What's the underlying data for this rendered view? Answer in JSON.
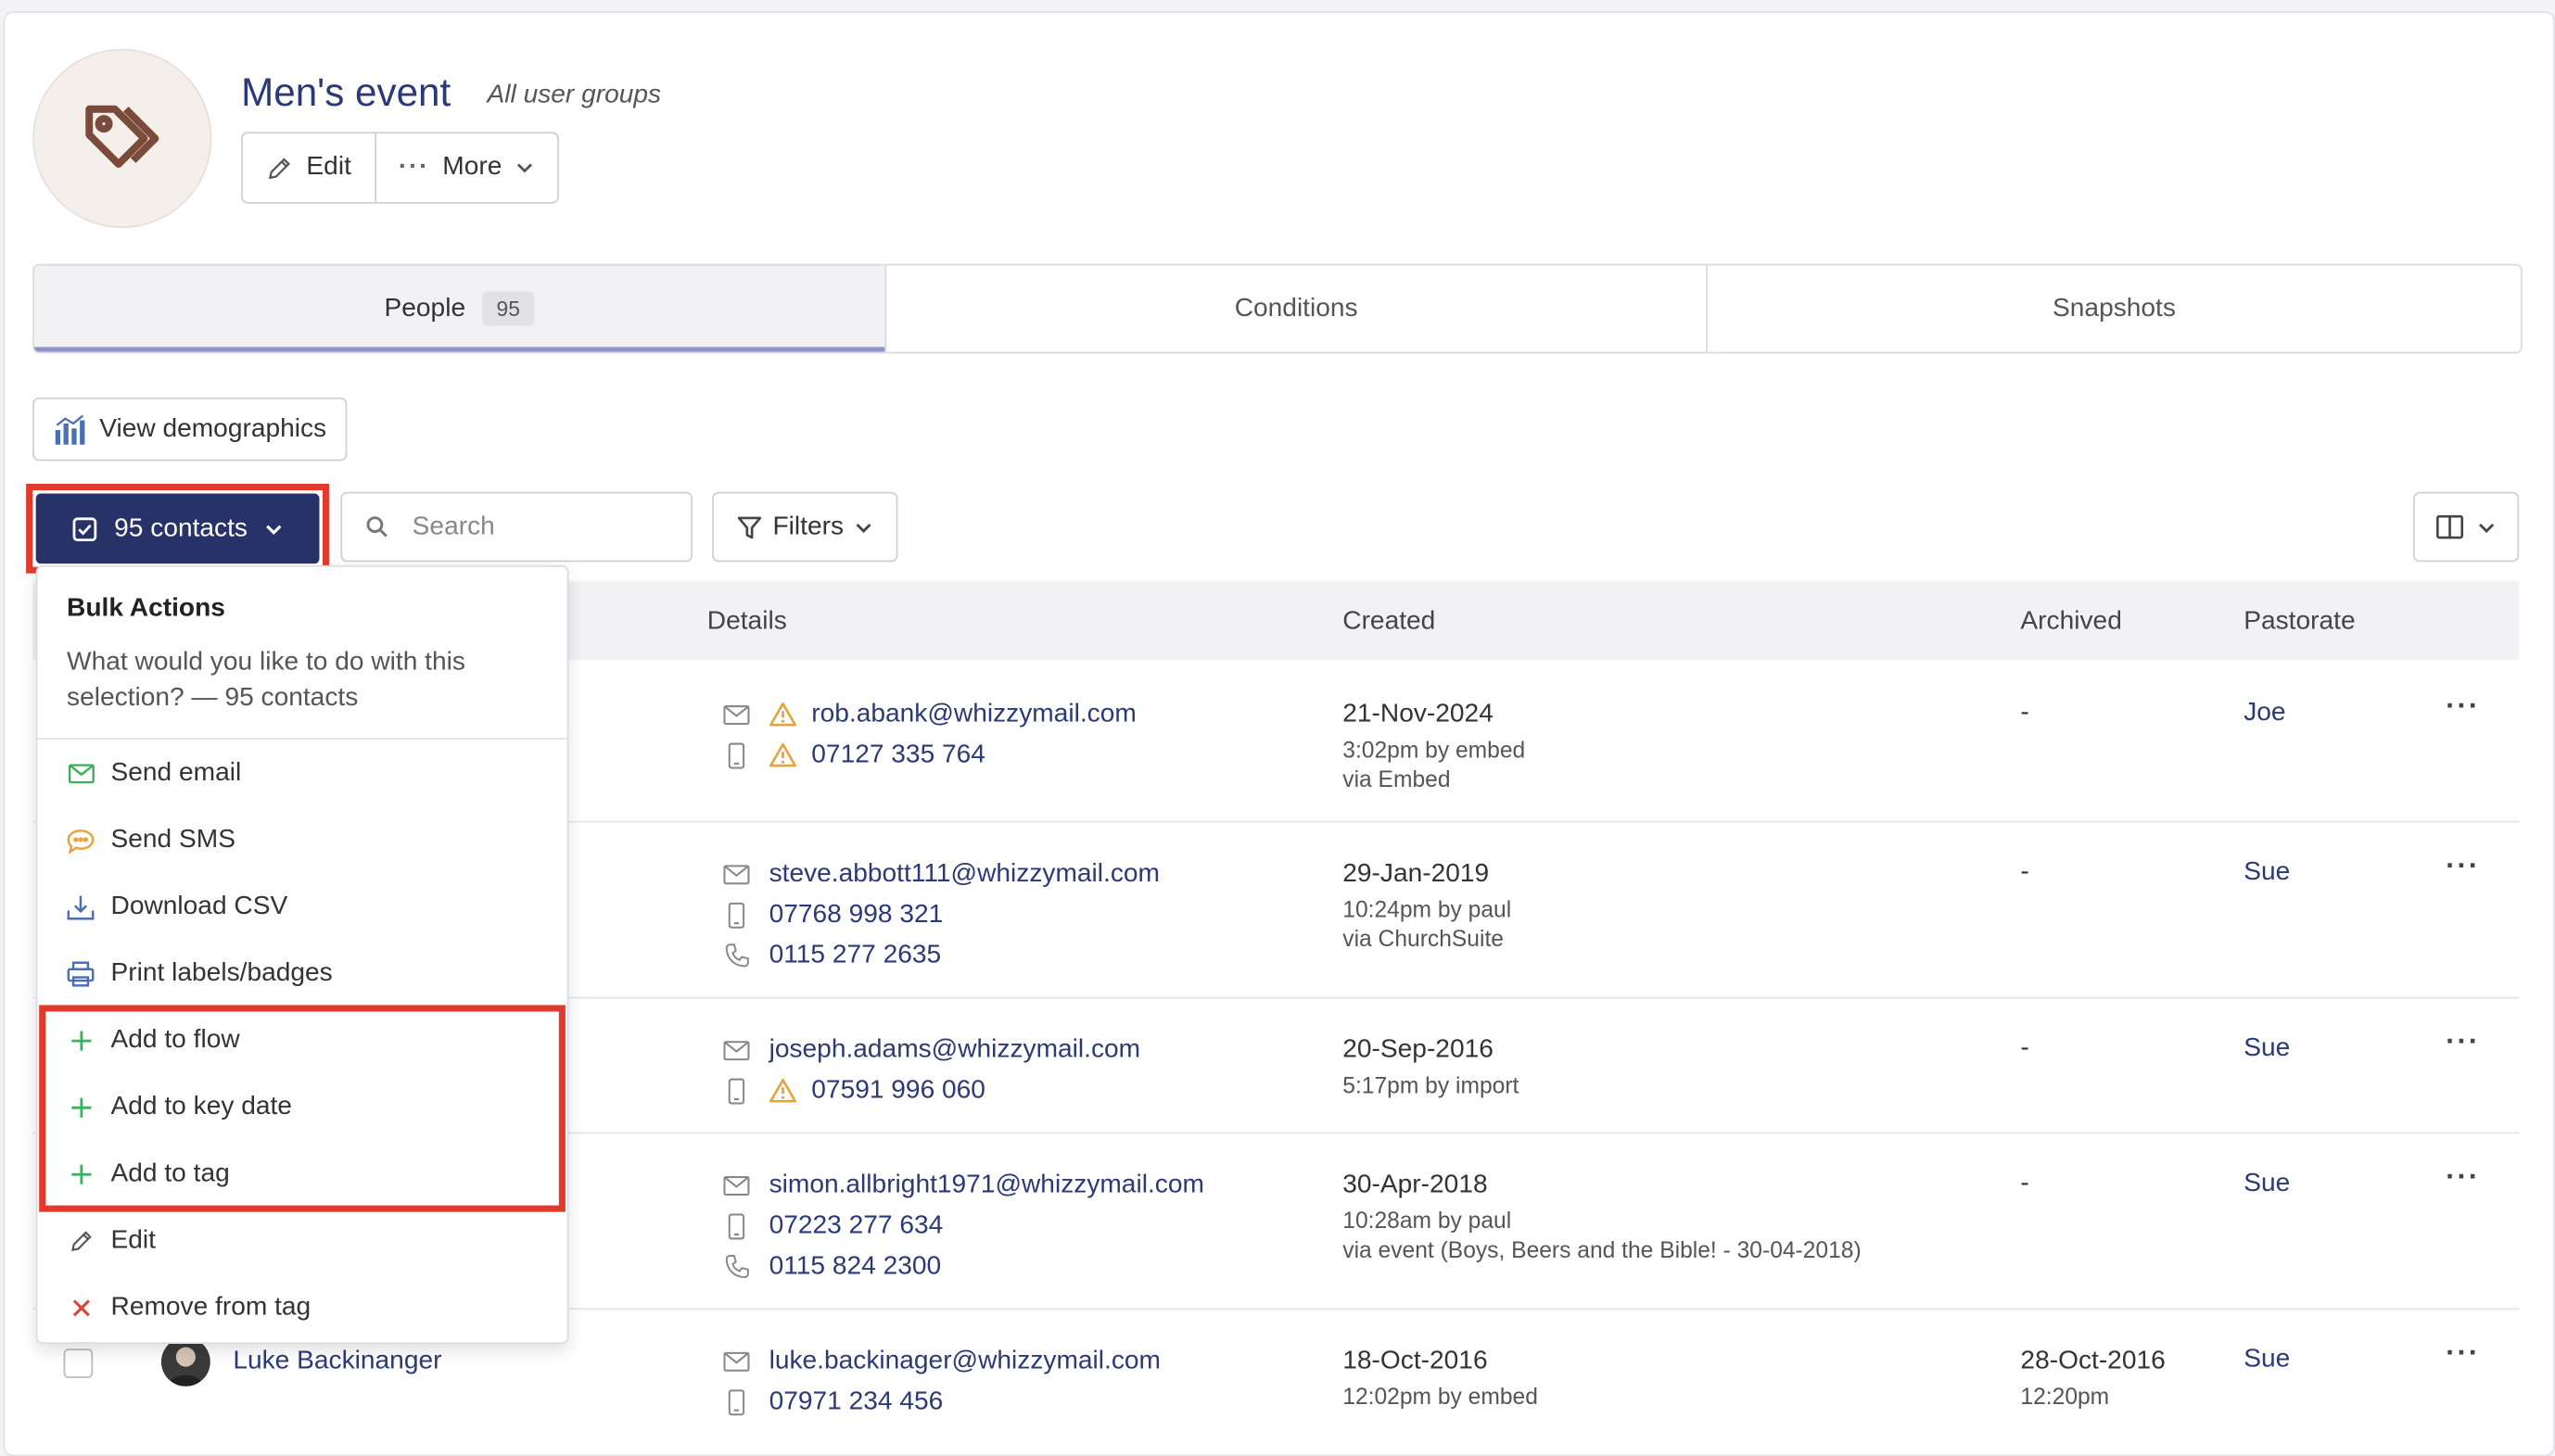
{
  "header": {
    "title": "Men's event",
    "subtitle": "All user groups",
    "edit_label": "Edit",
    "more_label": "More"
  },
  "tabs": [
    {
      "label": "People",
      "count": "95"
    },
    {
      "label": "Conditions"
    },
    {
      "label": "Snapshots"
    }
  ],
  "toolbar": {
    "demographics_label": "View demographics",
    "contacts_label": "95 contacts",
    "search_placeholder": "Search",
    "filters_label": "Filters"
  },
  "table": {
    "columns": {
      "details": "Details",
      "created": "Created",
      "archived": "Archived",
      "pastorate": "Pastorate"
    },
    "rows": [
      {
        "email": "rob.abank@whizzymail.com",
        "email_warning": true,
        "mobile": "07127 335 764",
        "mobile_warning": true,
        "created_date": "21-Nov-2024",
        "created_by": "3:02pm by embed",
        "created_via": "via Embed",
        "archived": "-",
        "pastorate": "Joe"
      },
      {
        "email": "steve.abbott111@whizzymail.com",
        "mobile": "07768 998 321",
        "phone": "0115 277 2635",
        "created_date": "29-Jan-2019",
        "created_by": "10:24pm by paul",
        "created_via": "via ChurchSuite",
        "archived": "-",
        "pastorate": "Sue"
      },
      {
        "email": "joseph.adams@whizzymail.com",
        "mobile": "07591 996 060",
        "mobile_warning": true,
        "created_date": "20-Sep-2016",
        "created_by": "5:17pm by import",
        "archived": "-",
        "pastorate": "Sue"
      },
      {
        "email": "simon.allbright1971@whizzymail.com",
        "mobile": "07223 277 634",
        "phone": "0115 824 2300",
        "created_date": "30-Apr-2018",
        "created_by": "10:28am by paul",
        "created_via": "via event (Boys, Beers and the Bible! - 30-04-2018)",
        "archived": "-",
        "pastorate": "Sue"
      },
      {
        "name": "Luke Backinanger",
        "email": "luke.backinager@whizzymail.com",
        "mobile": "07971 234 456",
        "created_date": "18-Oct-2016",
        "created_by": "12:02pm by embed",
        "archived": "28-Oct-2016",
        "archived_time": "12:20pm",
        "pastorate": "Sue"
      }
    ]
  },
  "bulk_menu": {
    "title": "Bulk Actions",
    "description": "What would you like to do with this selection? — 95 contacts",
    "items": [
      {
        "label": "Send email",
        "icon": "envelope-icon"
      },
      {
        "label": "Send SMS",
        "icon": "speech-bubble-icon"
      },
      {
        "label": "Download CSV",
        "icon": "download-icon"
      },
      {
        "label": "Print labels/badges",
        "icon": "printer-icon"
      },
      {
        "label": "Add to flow",
        "icon": "plus-icon"
      },
      {
        "label": "Add to key date",
        "icon": "plus-icon"
      },
      {
        "label": "Add to tag",
        "icon": "plus-icon"
      },
      {
        "label": "Edit",
        "icon": "pencil-icon"
      },
      {
        "label": "Remove from tag",
        "icon": "cross-icon"
      }
    ]
  },
  "colors": {
    "primary": "#263268",
    "link": "#2b3a77",
    "highlight": "#e23b2e",
    "warning": "#e8a33d",
    "success": "#3fae5a",
    "danger": "#d9453a"
  }
}
